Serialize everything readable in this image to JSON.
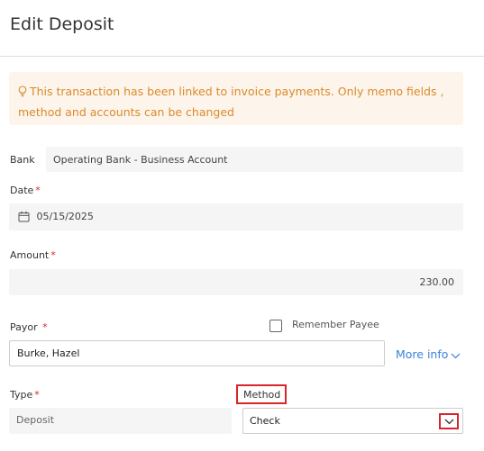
{
  "header": {
    "title": "Edit Deposit"
  },
  "notice": {
    "icon": "lightbulb-icon",
    "text": "This transaction has been linked to invoice payments. Only memo fields , method and accounts can be changed"
  },
  "bank": {
    "label": "Bank",
    "value": "Operating Bank - Business Account"
  },
  "date": {
    "label": "Date",
    "required_mark": "*",
    "value": "05/15/2025",
    "icon": "calendar-icon"
  },
  "amount": {
    "label": "Amount",
    "required_mark": "*",
    "value": "230.00"
  },
  "payor": {
    "label": "Payor",
    "required_mark": "*",
    "value": "Burke, Hazel",
    "remember_label": "Remember Payee",
    "remember_checked": false,
    "more_info": "More info"
  },
  "type": {
    "label": "Type",
    "required_mark": "*",
    "value": "Deposit"
  },
  "method": {
    "label": "Method",
    "value": "Check",
    "icon": "chevron-down-icon"
  },
  "colors": {
    "accent_link": "#3b82d6",
    "required": "#d9262b",
    "notice_text": "#d98a2b",
    "notice_bg": "#fdf5ec"
  }
}
